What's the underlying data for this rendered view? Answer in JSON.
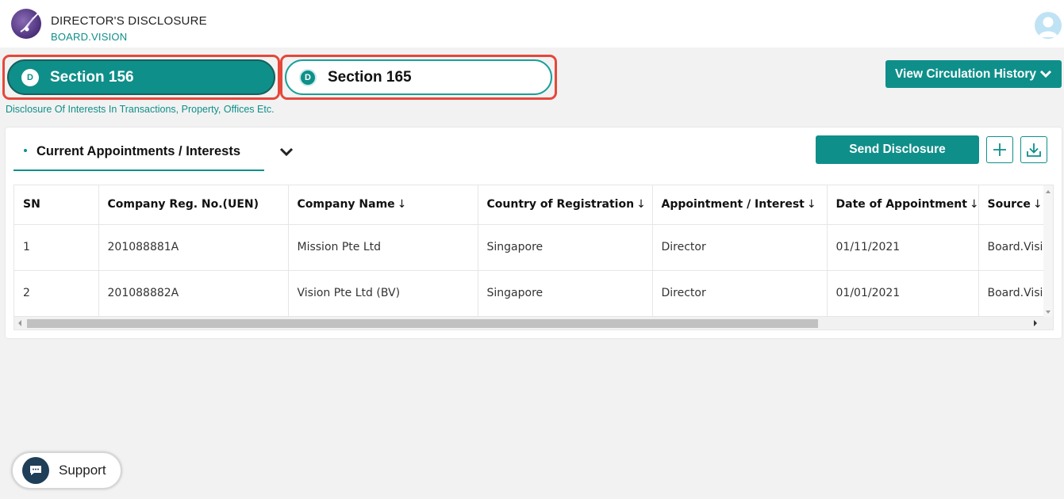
{
  "app": {
    "title": "DIRECTOR'S DISCLOSURE",
    "subtitle": "BOARD.VISION"
  },
  "sections": [
    {
      "badge": "D",
      "label": "Section 156",
      "active": true
    },
    {
      "badge": "D",
      "label": "Section 165",
      "active": false
    }
  ],
  "section_description": "Disclosure Of Interests In Transactions, Property, Offices Etc.",
  "view_history": {
    "label": "View Circulation History"
  },
  "panel": {
    "tab_label": "Current Appointments / Interests",
    "send_label": "Send Disclosure"
  },
  "table": {
    "columns": [
      {
        "label": "SN",
        "sortable": false
      },
      {
        "label": "Company Reg. No.(UEN)",
        "sortable": false
      },
      {
        "label": "Company Name",
        "sortable": true
      },
      {
        "label": "Country of Registration",
        "sortable": true
      },
      {
        "label": "Appointment / Interest",
        "sortable": true
      },
      {
        "label": "Date of Appointment",
        "sortable": true
      },
      {
        "label": "Source",
        "sortable": true
      }
    ],
    "sort_arrow": "↓",
    "rows": [
      [
        "1",
        "201088881A",
        "Mission Pte Ltd",
        "Singapore",
        "Director",
        "01/11/2021",
        "Board.Vision"
      ],
      [
        "2",
        "201088882A",
        "Vision Pte Ltd (BV)",
        "Singapore",
        "Director",
        "01/01/2021",
        "Board.Vision"
      ]
    ]
  },
  "support": {
    "label": "Support"
  },
  "colors": {
    "accent": "#0f8f8a",
    "highlight_border": "#e5483a",
    "background": "#f2f2f2"
  }
}
